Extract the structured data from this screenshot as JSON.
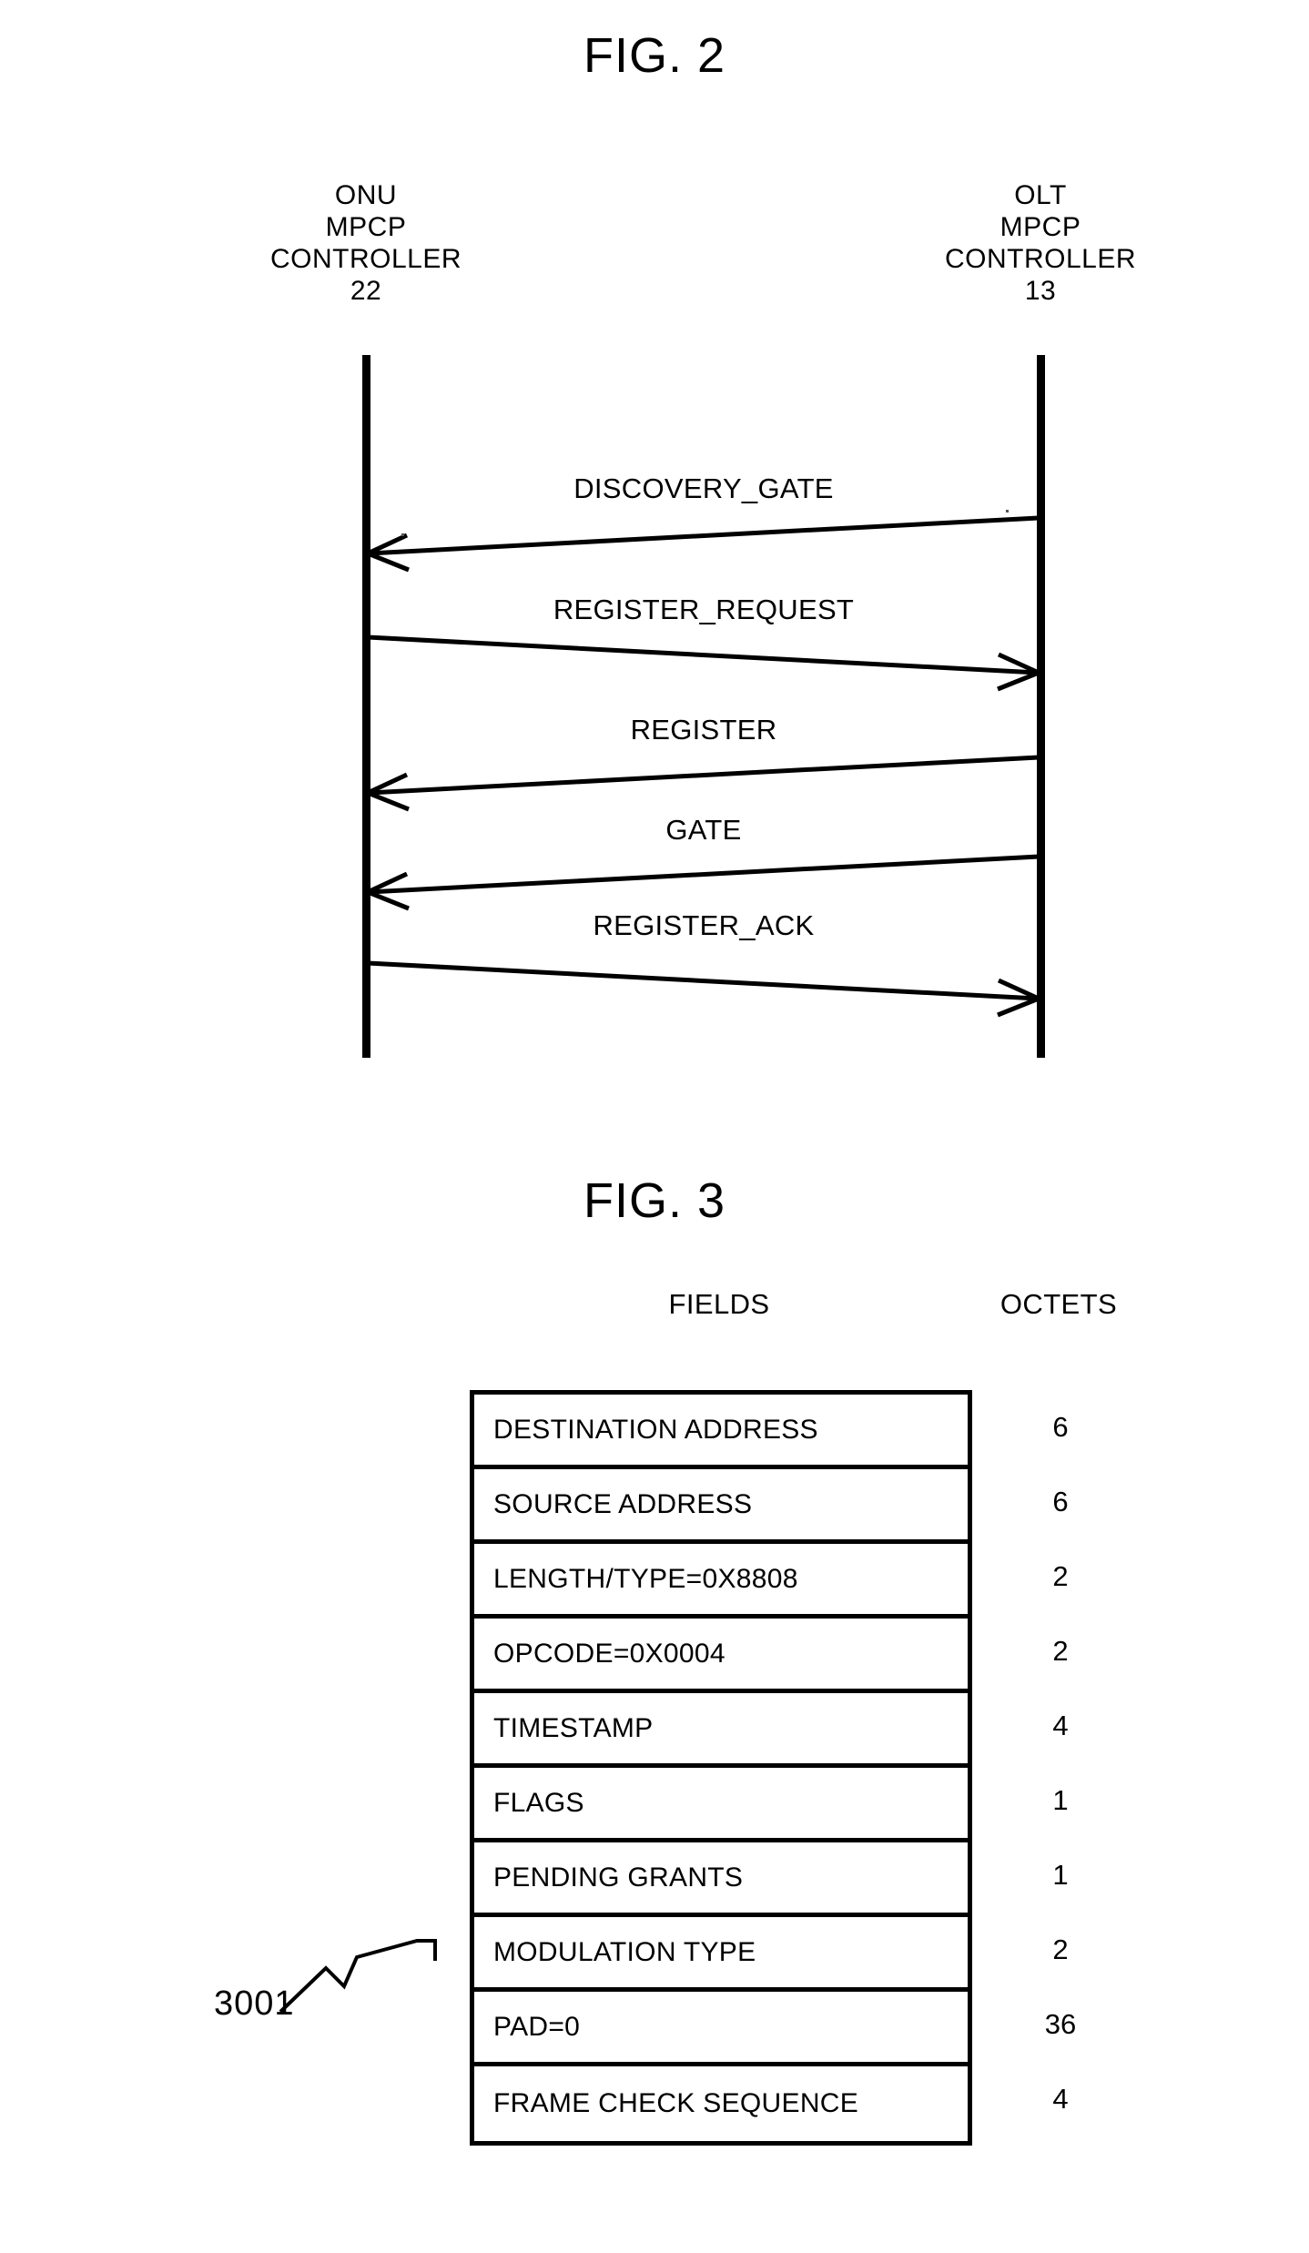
{
  "figures": {
    "fig2": {
      "title": "FIG. 2",
      "left_party": {
        "line1": "ONU",
        "line2": "MPCP",
        "line3": "CONTROLLER",
        "line4": "22"
      },
      "right_party": {
        "line1": "OLT",
        "line2": "MPCP",
        "line3": "CONTROLLER",
        "line4": "13"
      },
      "messages": [
        {
          "label": "DISCOVERY_GATE",
          "direction": "right-to-left"
        },
        {
          "label": "REGISTER_REQUEST",
          "direction": "left-to-right"
        },
        {
          "label": "REGISTER",
          "direction": "right-to-left"
        },
        {
          "label": "GATE",
          "direction": "right-to-left"
        },
        {
          "label": "REGISTER_ACK",
          "direction": "left-to-right"
        }
      ]
    },
    "fig3": {
      "title": "FIG. 3",
      "columns": {
        "fields": "FIELDS",
        "octets": "OCTETS"
      },
      "reference_numeral": "3001",
      "rows": [
        {
          "field": "DESTINATION ADDRESS",
          "octets": "6"
        },
        {
          "field": "SOURCE ADDRESS",
          "octets": "6"
        },
        {
          "field": "LENGTH/TYPE=0X8808",
          "octets": "2"
        },
        {
          "field": "OPCODE=0X0004",
          "octets": "2"
        },
        {
          "field": "TIMESTAMP",
          "octets": "4"
        },
        {
          "field": "FLAGS",
          "octets": "1"
        },
        {
          "field": "PENDING GRANTS",
          "octets": "1"
        },
        {
          "field": "MODULATION TYPE",
          "octets": "2"
        },
        {
          "field": "PAD=0",
          "octets": "36"
        },
        {
          "field": "FRAME CHECK SEQUENCE",
          "octets": "4"
        }
      ]
    }
  },
  "colors": {
    "ink": "#000000",
    "paper": "#ffffff"
  }
}
